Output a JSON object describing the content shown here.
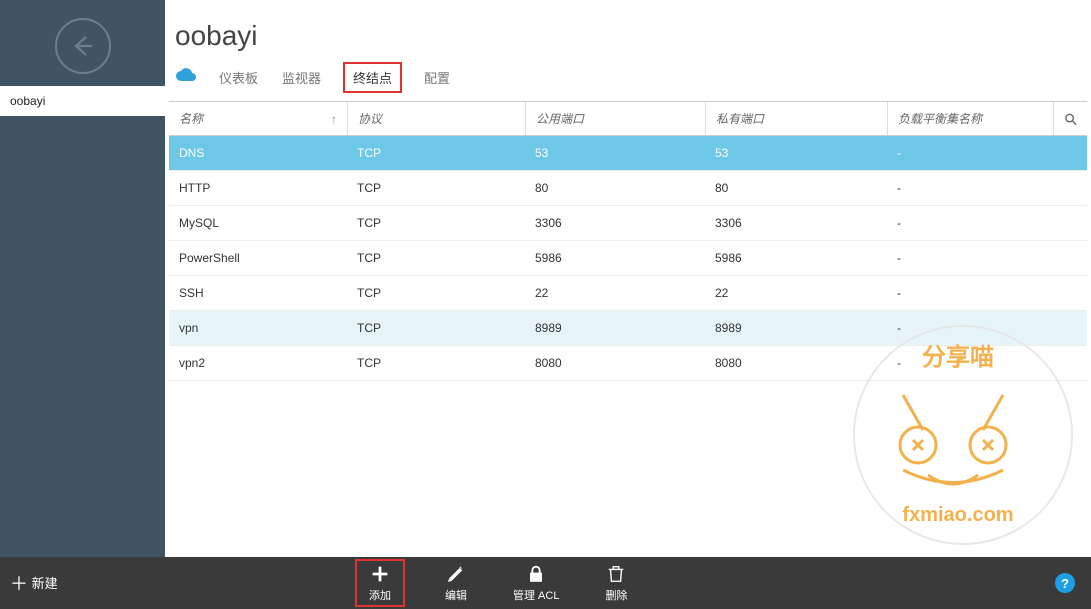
{
  "sidebar": {
    "item_label": "oobayi"
  },
  "page": {
    "title": "oobayi"
  },
  "tabs": {
    "items": [
      {
        "label": "仪表板"
      },
      {
        "label": "监视器"
      },
      {
        "label": "终结点"
      },
      {
        "label": "配置"
      }
    ],
    "active_index": 2
  },
  "table": {
    "headers": {
      "name": "名称",
      "protocol": "协议",
      "public_port": "公用端口",
      "private_port": "私有端口",
      "lb_set": "负载平衡集名称"
    },
    "sort_indicator": "↑",
    "rows": [
      {
        "name": "DNS",
        "protocol": "TCP",
        "public_port": "53",
        "private_port": "53",
        "lb": "-",
        "state": "selected"
      },
      {
        "name": "HTTP",
        "protocol": "TCP",
        "public_port": "80",
        "private_port": "80",
        "lb": "-",
        "state": ""
      },
      {
        "name": "MySQL",
        "protocol": "TCP",
        "public_port": "3306",
        "private_port": "3306",
        "lb": "-",
        "state": ""
      },
      {
        "name": "PowerShell",
        "protocol": "TCP",
        "public_port": "5986",
        "private_port": "5986",
        "lb": "-",
        "state": ""
      },
      {
        "name": "SSH",
        "protocol": "TCP",
        "public_port": "22",
        "private_port": "22",
        "lb": "-",
        "state": ""
      },
      {
        "name": "vpn",
        "protocol": "TCP",
        "public_port": "8989",
        "private_port": "8989",
        "lb": "-",
        "state": "alt"
      },
      {
        "name": "vpn2",
        "protocol": "TCP",
        "public_port": "8080",
        "private_port": "8080",
        "lb": "-",
        "state": ""
      }
    ]
  },
  "bottombar": {
    "new_label": "新建",
    "actions": {
      "add": "添加",
      "edit": "编辑",
      "acl": "管理 ACL",
      "delete": "删除"
    },
    "help": "?"
  },
  "watermark": {
    "line1": "分享喵",
    "line2": "fxmiao.com"
  }
}
